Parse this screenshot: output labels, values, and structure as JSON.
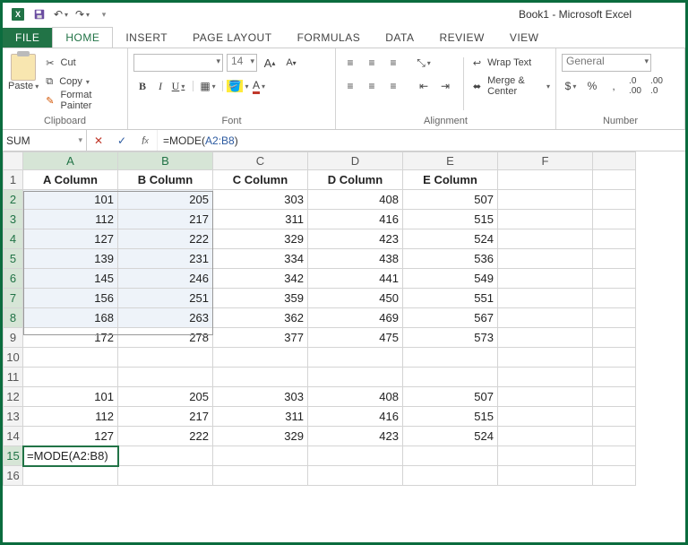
{
  "window": {
    "title": "Book1 - Microsoft Excel"
  },
  "tabs": {
    "file": "FILE",
    "items": [
      "HOME",
      "INSERT",
      "PAGE LAYOUT",
      "FORMULAS",
      "DATA",
      "REVIEW",
      "VIEW"
    ],
    "active": "HOME"
  },
  "ribbon": {
    "clipboard": {
      "paste": "Paste",
      "cut": "Cut",
      "copy": "Copy",
      "format_painter": "Format Painter",
      "label": "Clipboard"
    },
    "font": {
      "name": "",
      "size": "14",
      "bold": "B",
      "italic": "I",
      "underline": "U",
      "increase": "A",
      "decrease": "A",
      "label": "Font"
    },
    "alignment": {
      "wrap": "Wrap Text",
      "merge": "Merge & Center",
      "label": "Alignment"
    },
    "number": {
      "format": "General",
      "currency": "$",
      "percent": "%",
      "comma": ",",
      "inc_dec": ".0",
      "dec_dec": ".00",
      "label": "Number"
    }
  },
  "formula_bar": {
    "name_box": "SUM",
    "formula_prefix": "=MODE(",
    "formula_ref": "A2:B8",
    "formula_suffix": ")"
  },
  "sheet": {
    "headers": [
      "A Column",
      "B Column",
      "C Column",
      "D Column",
      "E Column"
    ],
    "rows": [
      [
        101,
        205,
        303,
        408,
        507
      ],
      [
        112,
        217,
        311,
        416,
        515
      ],
      [
        127,
        222,
        329,
        423,
        524
      ],
      [
        139,
        231,
        334,
        438,
        536
      ],
      [
        145,
        246,
        342,
        441,
        549
      ],
      [
        156,
        251,
        359,
        450,
        551
      ],
      [
        168,
        263,
        362,
        469,
        567
      ],
      [
        172,
        278,
        377,
        475,
        573
      ]
    ],
    "rows2": [
      [
        101,
        205,
        303,
        408,
        507
      ],
      [
        112,
        217,
        311,
        416,
        515
      ],
      [
        127,
        222,
        329,
        423,
        524
      ]
    ],
    "editing_cell": "=MODE(A2:B8)",
    "editing_row": 15,
    "selection": {
      "r1": 2,
      "c1": 1,
      "r2": 8,
      "c2": 2
    }
  }
}
